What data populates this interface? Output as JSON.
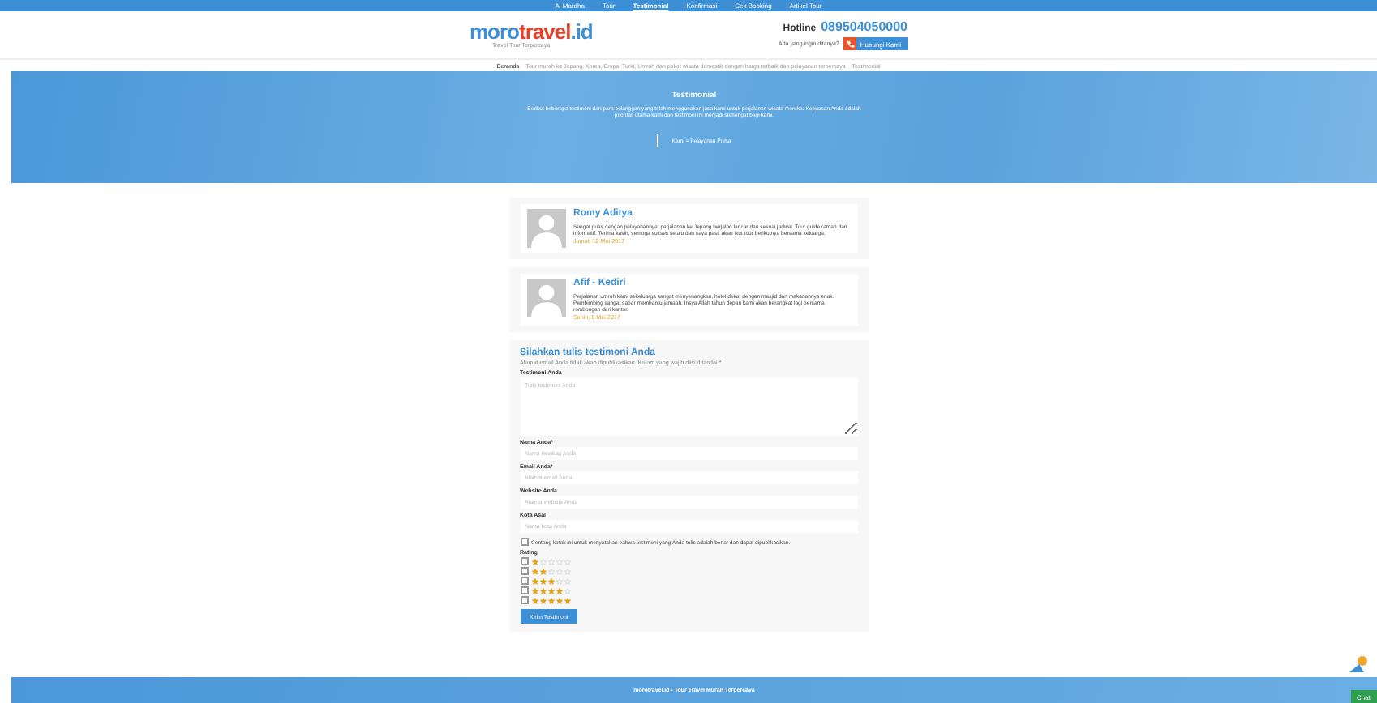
{
  "top_nav": [
    {
      "label": "Al Mardha",
      "selected": false
    },
    {
      "label": "Tour",
      "selected": false
    },
    {
      "label": "Testimonial",
      "selected": true
    },
    {
      "label": "Konfirmasi",
      "selected": false
    },
    {
      "label": "Cek Booking",
      "selected": false
    },
    {
      "label": "Artikel Tour",
      "selected": false
    }
  ],
  "header": {
    "logo_part1": "moro",
    "logo_part2": "travel",
    "logo_part3": ".id",
    "tagline": "Travel Tour Terpercaya",
    "hotline_label": "Hotline",
    "hotline_number": "089504050000",
    "question": "Ada yang ingin ditanya?",
    "call_button": "Hubungi Kami"
  },
  "breadcrumb": [
    {
      "label": "Beranda"
    },
    {
      "label": "Tour murah ke Jepang, Korea, Eropa, Turki, Umroh dan paket wisata domestik dengan harga terbaik dan pelayanan terpercaya"
    },
    {
      "label": "Testimonial"
    }
  ],
  "hero": {
    "title": "Testimonial",
    "text": "Berikut beberapa testimoni dari para pelanggan yang telah menggunakan jasa kami untuk perjalanan wisata mereka. Kepuasan Anda adalah prioritas utama kami dan testimoni ini menjadi semangat bagi kami.",
    "quote": "Kami = Pelayanan Prima"
  },
  "testimonials": [
    {
      "name": "Romy Aditya",
      "text": "Sangat puas dengan pelayanannya, perjalanan ke Jepang berjalan lancar dan sesuai jadwal. Tour guide ramah dan informatif. Terima kasih, semoga sukses selalu dan saya pasti akan ikut tour berikutnya bersama keluarga.",
      "date": "Jumat, 12 Mei 2017"
    },
    {
      "name": "Afif - Kediri",
      "text": "Perjalanan umroh kami sekeluarga sangat menyenangkan, hotel dekat dengan masjid dan makanannya enak. Pembimbing sangat sabar membantu jamaah. Insya Allah tahun depan kami akan berangkat lagi bersama rombongan dari kantor.",
      "date": "Senin, 8 Mei 2017"
    }
  ],
  "form": {
    "title": "Silahkan tulis testimoni Anda",
    "note": "Alamat email Anda tidak akan dipublikasikan. Kolom yang wajib diisi ditandai *",
    "fields": [
      {
        "kind": "textarea",
        "label": "Testimoni Anda",
        "placeholder": "Tulis testimoni Anda"
      },
      {
        "kind": "input",
        "label": "Nama Anda*",
        "placeholder": "Nama lengkap Anda"
      },
      {
        "kind": "input",
        "label": "Email Anda*",
        "placeholder": "Alamat email Anda"
      },
      {
        "kind": "input",
        "label": "Website Anda",
        "placeholder": "Alamat website Anda"
      },
      {
        "kind": "input",
        "label": "Kota Asal",
        "placeholder": "Nama kota Anda"
      }
    ],
    "agree": {
      "text": "Centang kotak ini untuk menyatakan bahwa testimoni yang Anda tulis adalah benar dan dapat dipublikasikan.",
      "checked": false
    },
    "rating_label": "Rating",
    "ratings": [
      {
        "stars": 1,
        "selected": false
      },
      {
        "stars": 2,
        "selected": false
      },
      {
        "stars": 3,
        "selected": false
      },
      {
        "stars": 4,
        "selected": false
      },
      {
        "stars": 5,
        "selected": false
      }
    ],
    "submit": "Kirim Testimoni"
  },
  "footer": {
    "text": "morotravel.id - Tour Travel Murah Terpercaya",
    "chat_button": "Chat"
  }
}
